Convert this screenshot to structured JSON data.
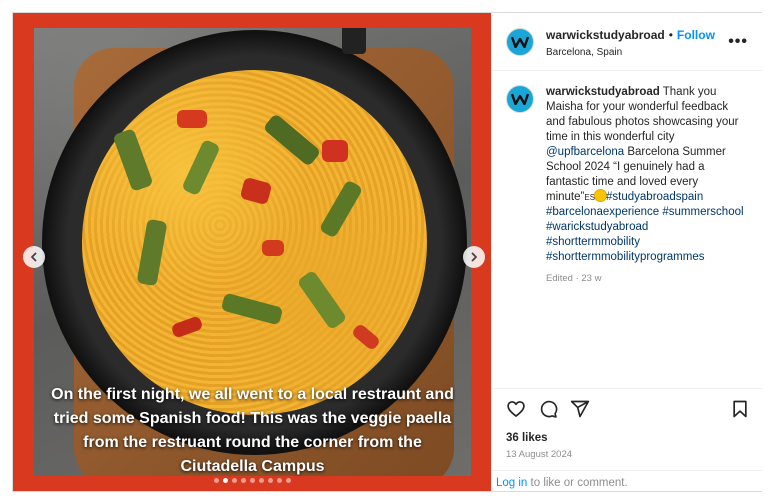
{
  "post": {
    "caption_lines": [
      "On the first night, we all went to a local restraunt and",
      "tried some Spanish food! This was the veggie paella",
      "from the restruant round the corner from the",
      "Ciutadella Campus"
    ],
    "carousel": {
      "total": 9,
      "active_index": 1
    }
  },
  "header": {
    "username": "warwickstudyabroad",
    "separator": "•",
    "follow_label": "Follow",
    "location": "Barcelona, Spain",
    "more_label": "•••"
  },
  "comment": {
    "username": "warwickstudyabroad",
    "text_1": " Thank you Maisha for your wonderful feedback and fabulous photos showcasing your time in this wonderful city ",
    "mention": "@upfbarcelona",
    "text_2": " Barcelona Summer School 2024 “I genuinely had a fantastic time and loved every minute”",
    "flag": "ES",
    "hashtags": [
      "#studyabroadspain",
      "#barcelonaexperience",
      "#summerschool",
      "#warickstudyabroad",
      "#shorttermmobility",
      "#shorttermmobilityprogrammes"
    ],
    "edited": "Edited · 23 w"
  },
  "footer": {
    "likes": "36 likes",
    "date": "13 August 2024",
    "login_link": "Log in",
    "login_text": " to like or comment."
  },
  "icons": [
    "heart-icon",
    "comment-icon",
    "share-icon",
    "bookmark-icon",
    "chevron-left-icon",
    "chevron-right-icon"
  ],
  "colors": {
    "media_bg": "#d8391f",
    "avatar_bg": "#1aa7d8",
    "follow": "#0095f6",
    "hashtag": "#00376b"
  }
}
